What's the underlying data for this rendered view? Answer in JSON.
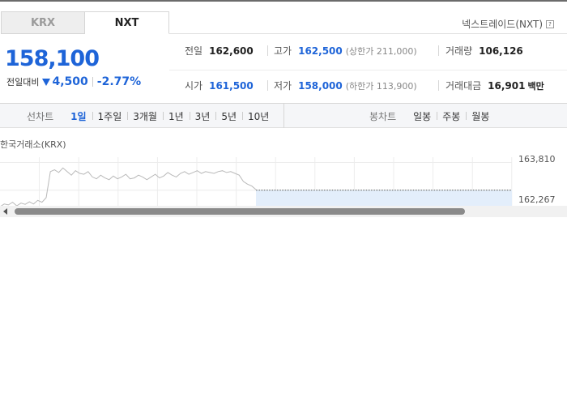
{
  "market_tabs": [
    {
      "label": "KRX",
      "active": false
    },
    {
      "label": "NXT",
      "active": true
    }
  ],
  "nxt_label": "넥스트레이드(NXT)",
  "price": "158,100",
  "change": {
    "label": "전일대비",
    "amount": "4,500",
    "percent": "-2.77%",
    "direction": "down"
  },
  "stats": {
    "prev_close": {
      "key": "전일",
      "value": "162,600"
    },
    "high": {
      "key": "고가",
      "value": "162,500",
      "sub": "(상한가 211,000)"
    },
    "volume": {
      "key": "거래량",
      "value": "106,126"
    },
    "open": {
      "key": "시가",
      "value": "161,500"
    },
    "low": {
      "key": "저가",
      "value": "158,000",
      "sub": "(하한가 113,900)"
    },
    "trade_value": {
      "key": "거래대금",
      "value": "16,901",
      "unit": "백만"
    }
  },
  "line_chart_options": {
    "title": "선차트",
    "items": [
      "1일",
      "1주일",
      "3개월",
      "1년",
      "3년",
      "5년",
      "10년"
    ],
    "selected": "1일"
  },
  "candle_chart_options": {
    "title": "봉차트",
    "items": [
      "일봉",
      "주봉",
      "월봉"
    ]
  },
  "chart_source": "한국거래소(KRX)",
  "chart_data": {
    "type": "line",
    "title": "",
    "xlabel": "",
    "ylabel": "",
    "y_tick_labels": [
      "163,810",
      "162,267"
    ],
    "ylim": [
      161400,
      164100
    ],
    "reference_line": 162267,
    "series": [
      {
        "values": [
          161350,
          161500,
          161450,
          161600,
          161400,
          161550,
          161480,
          161620,
          161500,
          161700,
          161600,
          161850,
          163300,
          163400,
          163250,
          163500,
          163300,
          163100,
          163350,
          163200,
          163150,
          163300,
          163000,
          162900,
          163100,
          162950,
          162850,
          163050,
          162900,
          163000,
          163150,
          162900,
          162950,
          163100,
          163000,
          162850,
          163000,
          163150,
          162950,
          163050,
          163250,
          163100,
          163000,
          163200,
          163300,
          163150,
          163250,
          163350,
          163200,
          163300,
          163250,
          163200,
          163300,
          163350,
          163250,
          163300,
          163200,
          163100,
          162750,
          162600,
          162500,
          162300
        ]
      }
    ]
  },
  "colors": {
    "accent": "#1e64d8",
    "chart_line": "#b9b9b9",
    "chart_fill": "#e3eefb"
  }
}
